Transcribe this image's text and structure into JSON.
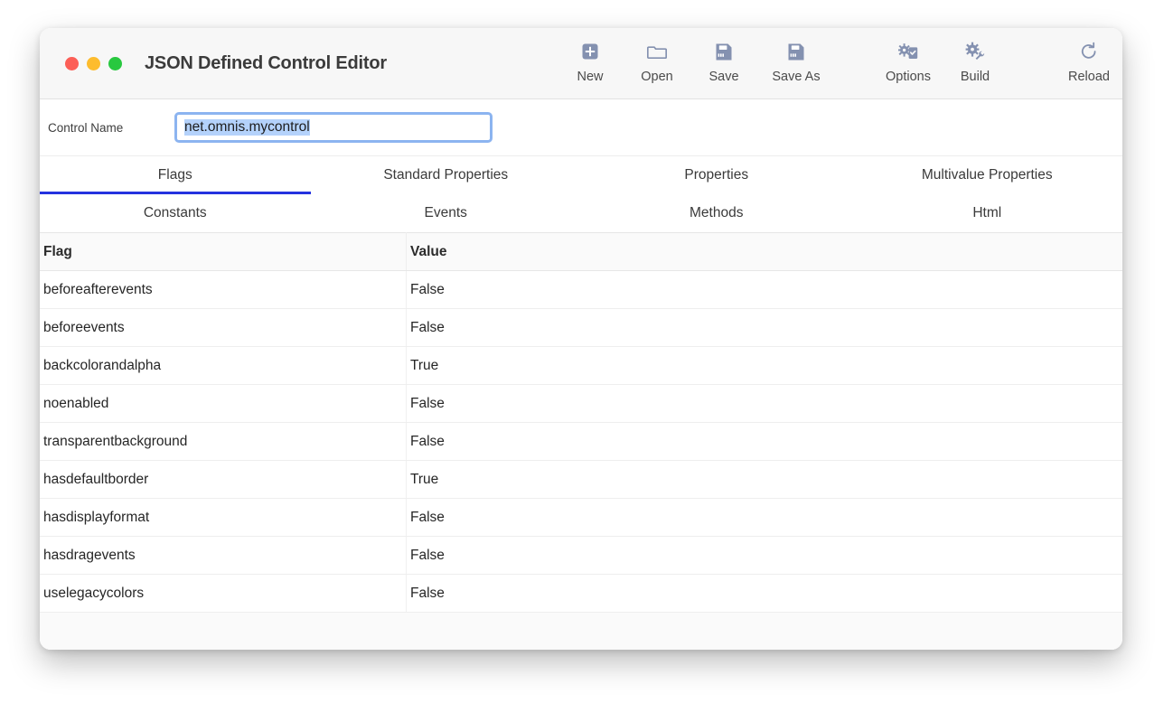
{
  "window": {
    "title": "JSON Defined Control Editor",
    "traffic_lights": [
      {
        "name": "close",
        "color": "#fc5f57"
      },
      {
        "name": "minimize",
        "color": "#fdbc2e"
      },
      {
        "name": "maximize",
        "color": "#28c83f"
      }
    ]
  },
  "toolbar": {
    "buttons": [
      {
        "label": "New",
        "icon": "new-plus-icon"
      },
      {
        "label": "Open",
        "icon": "folder-icon"
      },
      {
        "label": "Save",
        "icon": "floppy-disk-icon"
      },
      {
        "label": "Save As",
        "icon": "floppy-disk-icon"
      },
      {
        "label": "Options",
        "icon": "gear-checklist-icon"
      },
      {
        "label": "Build",
        "icon": "gear-wrench-icon"
      },
      {
        "label": "Reload",
        "icon": "refresh-icon"
      }
    ]
  },
  "control_name": {
    "label": "Control Name",
    "value": "net.omnis.mycontrol",
    "placeholder": "net.omnis.mycontrol",
    "selected": true,
    "focus_ring_color": "#8cb4f0",
    "selection_color": "#b4d2fb"
  },
  "tabs": {
    "active": "Flags",
    "accent_color": "#2432df",
    "row1": [
      {
        "label": "Flags",
        "active": true
      },
      {
        "label": "Standard Properties",
        "active": false
      },
      {
        "label": "Properties",
        "active": false
      },
      {
        "label": "Multivalue Properties",
        "active": false
      }
    ],
    "row2": [
      {
        "label": "Constants",
        "active": false
      },
      {
        "label": "Events",
        "active": false
      },
      {
        "label": "Methods",
        "active": false
      },
      {
        "label": "Html",
        "active": false
      }
    ]
  },
  "table": {
    "columns": [
      "Flag",
      "Value"
    ],
    "rows": [
      {
        "flag": "beforeafterevents",
        "value": "False"
      },
      {
        "flag": "beforeevents",
        "value": "False"
      },
      {
        "flag": "backcolorandalpha",
        "value": "True"
      },
      {
        "flag": "noenabled",
        "value": "False"
      },
      {
        "flag": "transparentbackground",
        "value": "False"
      },
      {
        "flag": "hasdefaultborder",
        "value": "True"
      },
      {
        "flag": "hasdisplayformat",
        "value": "False"
      },
      {
        "flag": "hasdragevents",
        "value": "False"
      },
      {
        "flag": "uselegacycolors",
        "value": "False"
      }
    ]
  }
}
